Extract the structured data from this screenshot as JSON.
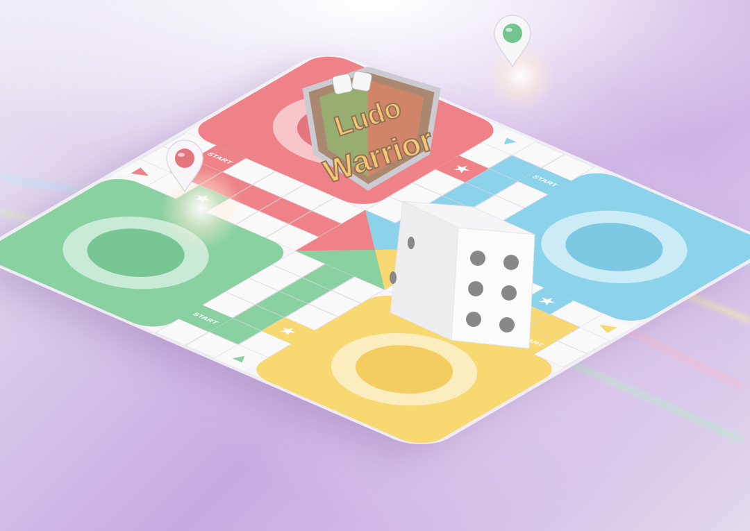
{
  "game": {
    "logo_top": "Ludo",
    "logo_bottom": "Warrior"
  },
  "board": {
    "start_labels": [
      "START",
      "START",
      "START",
      "START"
    ],
    "quadrant_colors": {
      "red": "#e8535a",
      "blue": "#5fc3e4",
      "yellow": "#f5c93a",
      "green": "#5cbf7d"
    },
    "emblem_text": "Ludo"
  },
  "dice": {
    "face_value": 6,
    "side_value": 3
  },
  "pins": [
    {
      "color": "red",
      "hex": "#d9414a"
    },
    {
      "color": "green",
      "hex": "#3fae63"
    }
  ]
}
